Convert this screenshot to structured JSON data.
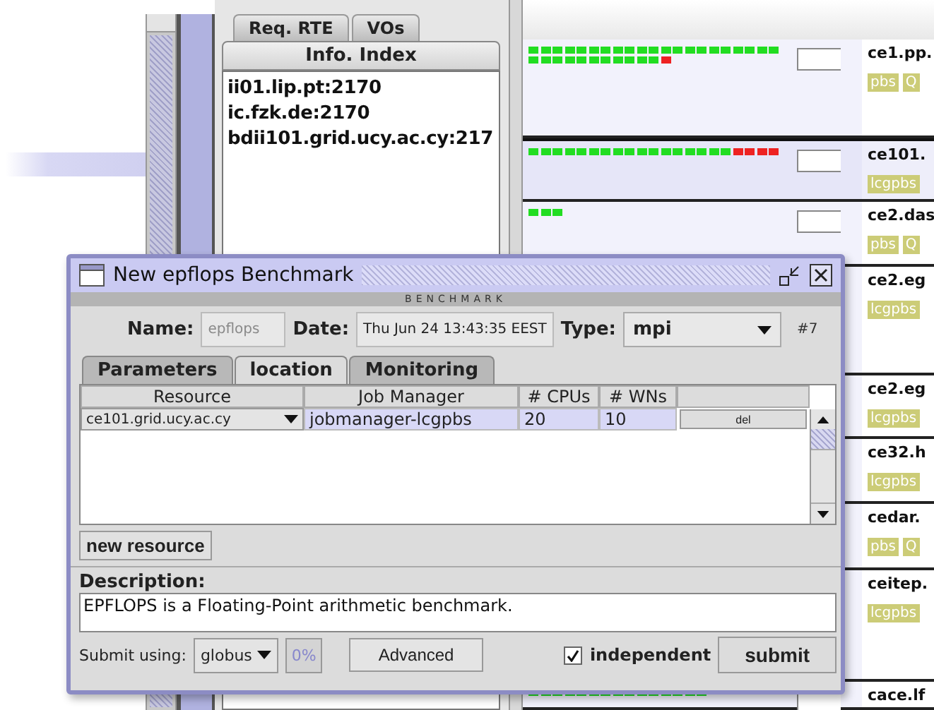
{
  "background": {
    "tabs": [
      {
        "label": "Req. RTE",
        "selected": false
      },
      {
        "label": "VOs",
        "selected": false
      }
    ],
    "subtab": {
      "label": "Info. Index",
      "selected": true
    },
    "index_list": [
      "ii01.lip.pt:2170",
      "ic.fzk.de:2170",
      "bdii101.grid.ucy.ac.cy:217"
    ],
    "resources": [
      {
        "name": "ce1.pp.",
        "selected": false,
        "tags": [
          "pbs",
          "Q"
        ],
        "nodes": [
          {
            "busy": false
          },
          {
            "busy": false
          },
          {
            "busy": false
          },
          {
            "busy": false
          },
          {
            "busy": false
          },
          {
            "busy": false
          },
          {
            "busy": false
          },
          {
            "busy": false
          },
          {
            "busy": false
          },
          {
            "busy": false
          },
          {
            "busy": false
          },
          {
            "busy": false
          },
          {
            "busy": false
          },
          {
            "busy": false
          },
          {
            "busy": false
          },
          {
            "busy": false
          },
          {
            "busy": false
          },
          {
            "busy": false
          },
          {
            "busy": false
          },
          {
            "busy": false
          },
          {
            "busy": false
          },
          {
            "busy": false
          },
          {
            "busy": false
          },
          {
            "busy": false
          },
          {
            "busy": false
          },
          {
            "busy": false
          },
          {
            "busy": false
          },
          {
            "busy": false
          },
          {
            "busy": false
          },
          {
            "busy": false
          },
          {
            "busy": false
          },
          {
            "busy": false
          },
          {
            "busy": true
          }
        ]
      },
      {
        "name": "ce101.",
        "selected": true,
        "tags": [
          "lcgpbs"
        ],
        "nodes": [
          {
            "busy": false
          },
          {
            "busy": false
          },
          {
            "busy": false
          },
          {
            "busy": false
          },
          {
            "busy": false
          },
          {
            "busy": false
          },
          {
            "busy": false
          },
          {
            "busy": false
          },
          {
            "busy": false
          },
          {
            "busy": false
          },
          {
            "busy": false
          },
          {
            "busy": false
          },
          {
            "busy": false
          },
          {
            "busy": false
          },
          {
            "busy": false
          },
          {
            "busy": false
          },
          {
            "busy": false
          },
          {
            "busy": true
          },
          {
            "busy": true
          },
          {
            "busy": true
          },
          {
            "busy": true
          }
        ]
      },
      {
        "name": "ce2.das",
        "selected": false,
        "tags": [
          "pbs",
          "Q"
        ],
        "nodes": [
          {
            "busy": false
          },
          {
            "busy": false
          },
          {
            "busy": false
          }
        ]
      },
      {
        "name": "ce2.eg",
        "selected": false,
        "tags": [
          "lcgpbs"
        ]
      },
      {
        "name": "ce2.eg",
        "selected": false,
        "tags": [
          "lcgpbs"
        ]
      },
      {
        "name": "ce32.h",
        "selected": false,
        "tags": [
          "lcgpbs"
        ]
      },
      {
        "name": "cedar.",
        "selected": false,
        "tags": [
          "pbs",
          "Q"
        ]
      },
      {
        "name": "ceitep.",
        "selected": false,
        "tags": [
          "lcgpbs"
        ]
      },
      {
        "name": "cace.lf",
        "selected": false,
        "nodes": [
          {
            "busy": false
          },
          {
            "busy": false
          },
          {
            "busy": false
          },
          {
            "busy": false
          },
          {
            "busy": false
          },
          {
            "busy": false
          },
          {
            "busy": false
          },
          {
            "busy": false
          },
          {
            "busy": false
          },
          {
            "busy": false
          },
          {
            "busy": false
          },
          {
            "busy": false
          },
          {
            "busy": false
          },
          {
            "busy": false
          },
          {
            "busy": false
          }
        ]
      }
    ]
  },
  "dialog": {
    "title": "New epflops Benchmark",
    "section": "BENCHMARK",
    "name": {
      "label": "Name:",
      "value": "epflops",
      "disabled": true
    },
    "date": {
      "label": "Date:",
      "value": "Thu Jun 24 13:43:35 EEST"
    },
    "type": {
      "label": "Type:",
      "value": "mpi"
    },
    "number": "#7",
    "tabs": [
      {
        "label": "Parameters",
        "selected": false
      },
      {
        "label": "location",
        "selected": true
      },
      {
        "label": "Monitoring",
        "selected": false
      }
    ],
    "table": {
      "columns": [
        "Resource",
        "Job Manager",
        "# CPUs",
        "# WNs"
      ],
      "rows": [
        {
          "resource": "ce101.grid.ucy.ac.cy",
          "job_manager": "jobmanager-lcgpbs",
          "cpus": "20",
          "wns": "10",
          "action": "del"
        }
      ]
    },
    "new_resource": "new resource",
    "description": {
      "label": "Description:",
      "value": "EPFLOPS is a Floating-Point arithmetic benchmark."
    },
    "submit_using": {
      "label": "Submit using:",
      "value": "globus"
    },
    "progress": "0%",
    "advanced": "Advanced",
    "independent": {
      "label": "independent",
      "checked": true
    },
    "submit": "submit"
  }
}
